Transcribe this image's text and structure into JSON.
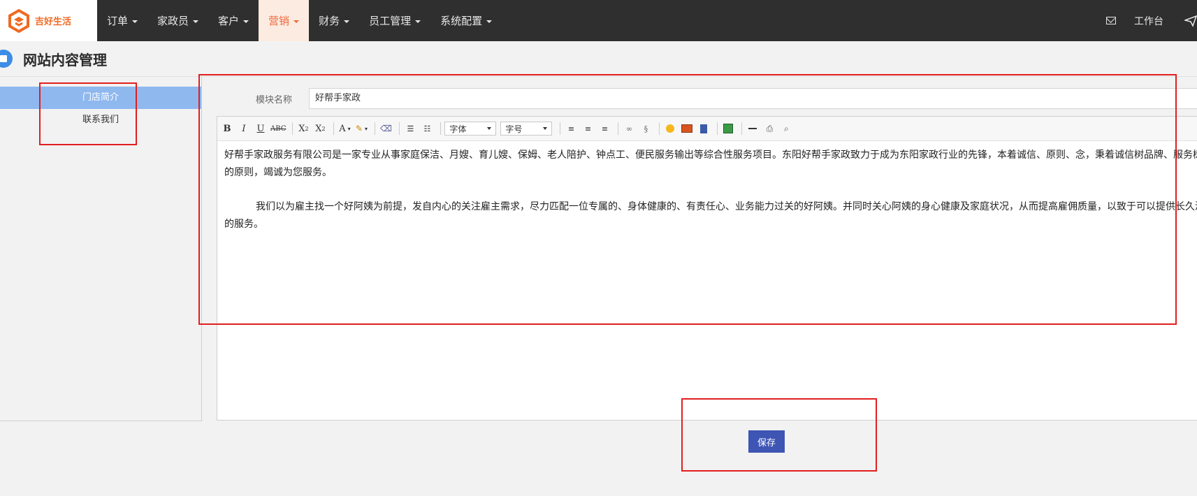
{
  "app": {
    "logo_text": "吉好生活",
    "brand_color": "#f06a22"
  },
  "nav": {
    "items": [
      {
        "label": "订单",
        "caret": true
      },
      {
        "label": "家政员",
        "caret": true
      },
      {
        "label": "客户",
        "caret": true
      },
      {
        "label": "营销",
        "caret": true,
        "active": true
      },
      {
        "label": "财务",
        "caret": true
      },
      {
        "label": "员工管理",
        "caret": true
      },
      {
        "label": "系统配置",
        "caret": true
      }
    ],
    "right": {
      "mail_icon": "mail-icon",
      "workbench_label": "工作台",
      "plane_icon": "send-icon"
    }
  },
  "page": {
    "title": "网站内容管理"
  },
  "sidebar": {
    "items": [
      {
        "label": "门店简介",
        "active": true
      },
      {
        "label": "联系我们",
        "active": false
      }
    ]
  },
  "form": {
    "module_name_label": "模块名称",
    "module_name_value": "好帮手家政",
    "toolbar": {
      "font_family": "字体",
      "font_size": "字号"
    },
    "content": {
      "para1": "好帮手家政服务有限公司是一家专业从事家庭保洁、月嫂、育儿嫂、保姆、老人陪护、钟点工、便民服务输出等综合性服务项目。东阳好帮手家政致力于成为东阳家政行业的先锋，本着诚信、原则、念，秉着诚信树品牌、服务树口碑的原则，竭诚为您服务。",
      "para2": "我们以为雇主找一个好阿姨为前提，发自内心的关注雇主需求，尽力匹配一位专属的、身体健康的、有责任心、业务能力过关的好阿姨。并同时关心阿姨的身心健康及家庭状况，从而提高雇佣质量，以致于可以提供长久满意的服务。"
    },
    "save_label": "保存"
  },
  "colors": {
    "topbar": "#2f2f2f",
    "active_nav_bg": "#fbebe0",
    "active_nav_text": "#f0683c",
    "sidebar_active": "#8fb8ef",
    "save_button": "#3e55b4",
    "annotation_red": "#e21e1e"
  }
}
